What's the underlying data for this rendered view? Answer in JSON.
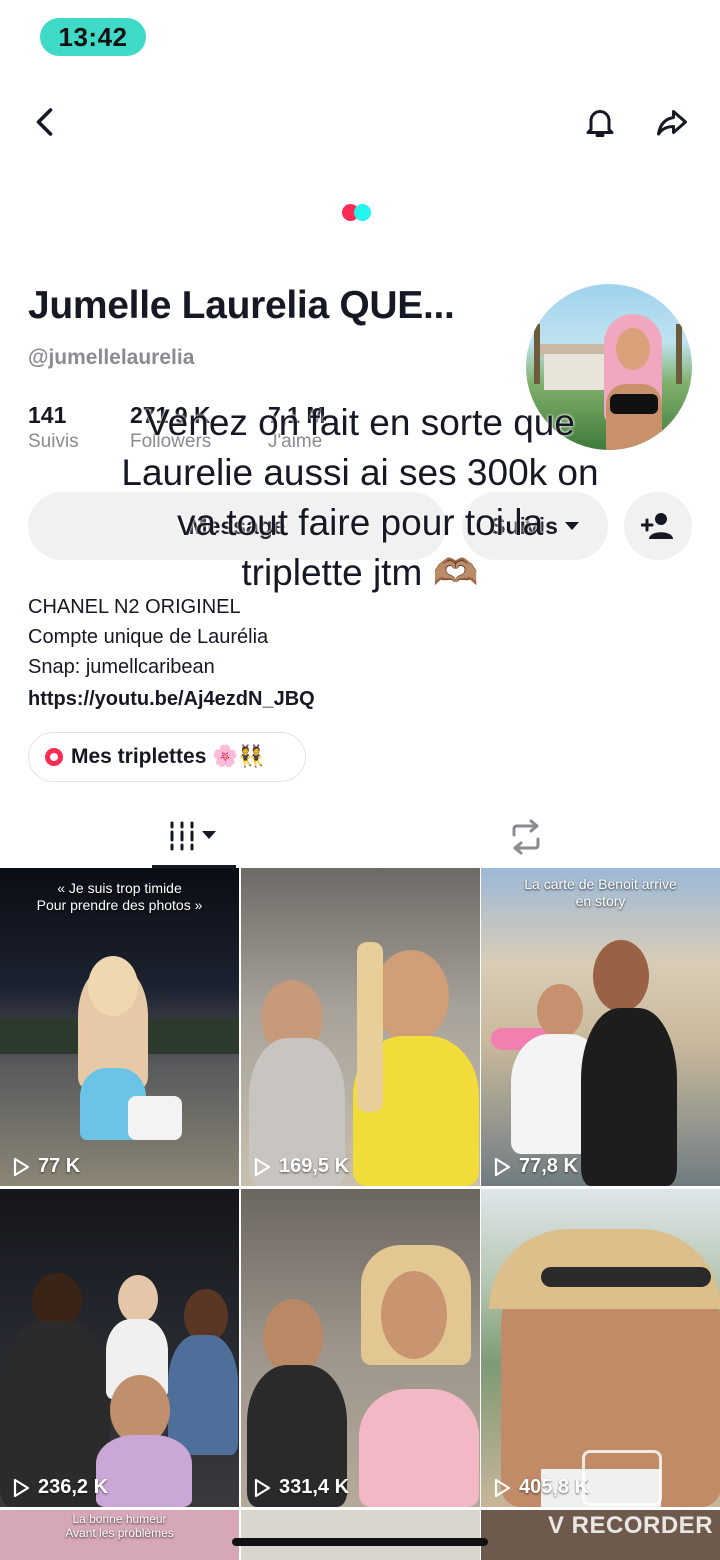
{
  "status_bar": {
    "time": "13:42"
  },
  "header": {
    "back_icon": "chevron-left-icon",
    "bell_icon": "bell-icon",
    "share_icon": "share-arrow-icon"
  },
  "loader_colors": [
    "#fe2c55",
    "#25f4ee"
  ],
  "profile": {
    "display_name": "Jumelle Laurelia QUE...",
    "username": "@jumellelaurelia",
    "stats": [
      {
        "value": "141",
        "label": "Suivis"
      },
      {
        "value": "271,9 K",
        "label": "Followers"
      },
      {
        "value": "7,1 M",
        "label": "J'aime"
      }
    ],
    "message_label": "Message",
    "follow_label": "Suivis",
    "bio_lines": [
      "CHANEL N2 ORIGINEL",
      "Compte unique de Laurélia",
      "Snap: jumellcaribean"
    ],
    "link": "https://youtu.be/Aj4ezdN_JBQ",
    "playlist_label": "Mes triplettes 🌸👯"
  },
  "overlay_caption": "Venez on fait en sorte que\nLaurelie aussi ai ses 300k on\nva tout faire pour toi la\ntriplette jtm 🫶🏽",
  "tabs": {
    "videos_icon": "grid-icon",
    "reposts_icon": "repost-icon"
  },
  "videos": [
    {
      "views": "77 K",
      "caption": "« Je suis trop timide\nPour prendre des photos »"
    },
    {
      "views": "169,5 K",
      "caption": ""
    },
    {
      "views": "77,8 K",
      "caption": "La carte de Benoit arrive\nen story"
    },
    {
      "views": "236,2 K",
      "caption": ""
    },
    {
      "views": "331,4 K",
      "caption": ""
    },
    {
      "views": "405,8 K",
      "caption": ""
    }
  ],
  "bottom_row": {
    "caption": "La bonne humeur\nAvant les problèmes"
  },
  "watermark": "V RECORDER",
  "accent_color": "#fe2c55"
}
